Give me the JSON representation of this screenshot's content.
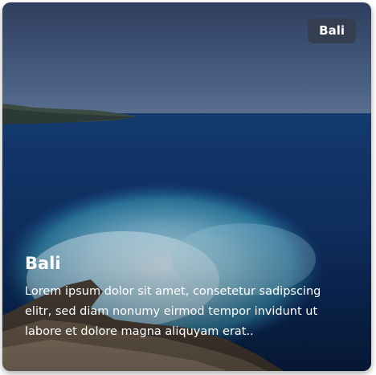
{
  "card": {
    "badge": "Bali",
    "title": "Bali",
    "description": "Lorem ipsum dolor sit amet, consetetur sadipscing elitr, sed diam nonumy eirmod tempor invidunt ut labore et dolore magna aliquyam erat.."
  },
  "colors": {
    "sky": "#4a5f85",
    "ocean_deep": "#0e2a5c",
    "surf": "#6fb3c6",
    "badge_bg": "#343e4e",
    "text": "#ffffff"
  }
}
